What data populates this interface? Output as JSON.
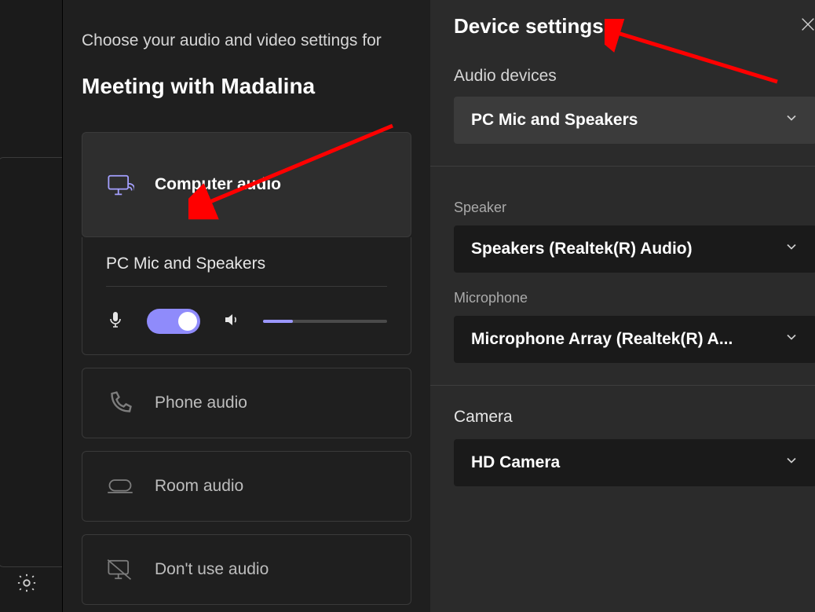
{
  "prejoin": {
    "prompt": "Choose your audio and video settings for",
    "meeting_title": "Meeting with Madalina",
    "options": {
      "computer_audio": "Computer audio",
      "phone_audio": "Phone audio",
      "room_audio": "Room audio",
      "dont_use_audio": "Don't use audio"
    },
    "detail": {
      "device_name": "PC Mic and Speakers"
    }
  },
  "panel": {
    "title": "Device settings",
    "audio_devices_label": "Audio devices",
    "audio_device_selected": "PC Mic and Speakers",
    "speaker_label": "Speaker",
    "speaker_selected": "Speakers (Realtek(R) Audio)",
    "microphone_label": "Microphone",
    "microphone_selected": "Microphone Array (Realtek(R) A...",
    "camera_label": "Camera",
    "camera_selected": "HD Camera"
  }
}
